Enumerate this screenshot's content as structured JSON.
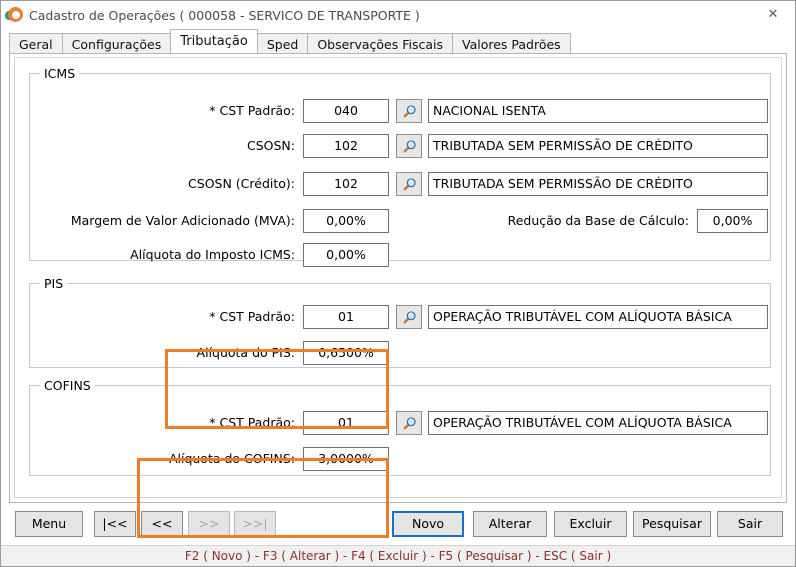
{
  "window": {
    "title": "Cadastro de Operações ( 000058 - SERVICO DE TRANSPORTE )",
    "logo_icon": "app-logo-icon",
    "close_icon": "close-icon",
    "close_label": "✕"
  },
  "tabs": [
    {
      "label": "Geral",
      "active": false
    },
    {
      "label": "Configurações",
      "active": false
    },
    {
      "label": "Tributação",
      "active": true
    },
    {
      "label": "Sped",
      "active": false
    },
    {
      "label": "Observações Fiscais",
      "active": false
    },
    {
      "label": "Valores Padrões",
      "active": false
    }
  ],
  "icms": {
    "legend": "ICMS",
    "cst_label": "* CST Padrão:",
    "cst_value": "040",
    "cst_desc": "NACIONAL ISENTA",
    "csosn_label": "CSOSN:",
    "csosn_value": "102",
    "csosn_desc": "TRIBUTADA SEM PERMISSÃO DE CRÉDITO",
    "csosn_cred_label": "CSOSN (Crédito):",
    "csosn_cred_value": "102",
    "csosn_cred_desc": "TRIBUTADA SEM PERMISSÃO DE CRÉDITO",
    "mva_label": "Margem de Valor Adicionado (MVA):",
    "mva_value": "0,00%",
    "reducao_label": "Redução da Base de Cálculo:",
    "reducao_value": "0,00%",
    "aliquota_label": "Alíquota do Imposto ICMS:",
    "aliquota_value": "0,00%",
    "lookup_icon": "magnifier-icon"
  },
  "pis": {
    "legend": "PIS",
    "cst_label": "* CST Padrão:",
    "cst_value": "01",
    "cst_desc": "OPERAÇÃO TRIBUTÁVEL COM ALÍQUOTA BÁSICA",
    "aliquota_label": "Alíquota do PIS:",
    "aliquota_value": "0,6500%",
    "lookup_icon": "magnifier-icon"
  },
  "cofins": {
    "legend": "COFINS",
    "cst_label": "* CST Padrão:",
    "cst_value": "01",
    "cst_desc": "OPERAÇÃO TRIBUTÁVEL COM ALÍQUOTA BÁSICA",
    "aliquota_label": "Alíquota do COFINS:",
    "aliquota_value": "3,0000%",
    "lookup_icon": "magnifier-icon"
  },
  "highlights": {
    "color": "#ee7d28",
    "pis_note": "destaque PIS",
    "cofins_note": "destaque COFINS"
  },
  "buttons": {
    "menu": "Menu",
    "first": "|<<",
    "prev": "<<",
    "next": ">>",
    "last": ">>|",
    "novo": "Novo",
    "alterar": "Alterar",
    "excluir": "Excluir",
    "pesquisar": "Pesquisar",
    "sair": "Sair"
  },
  "statusbar": {
    "text": "F2 ( Novo )  -  F3 ( Alterar )  -  F4 ( Excluir )  -  F5 ( Pesquisar )  -  ESC ( Sair )",
    "color": "#8b2f2f"
  }
}
